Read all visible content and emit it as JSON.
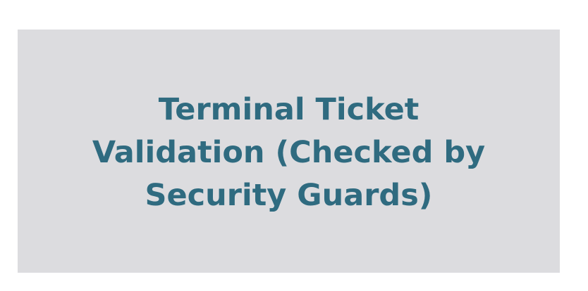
{
  "card": {
    "title_lines": [
      "Terminal Ticket",
      "Validation (Checked by",
      "Security Guards)"
    ]
  },
  "colors": {
    "panel_background": "#dcdcdf",
    "title_text": "#2f6b80",
    "page_background": "#ffffff"
  }
}
